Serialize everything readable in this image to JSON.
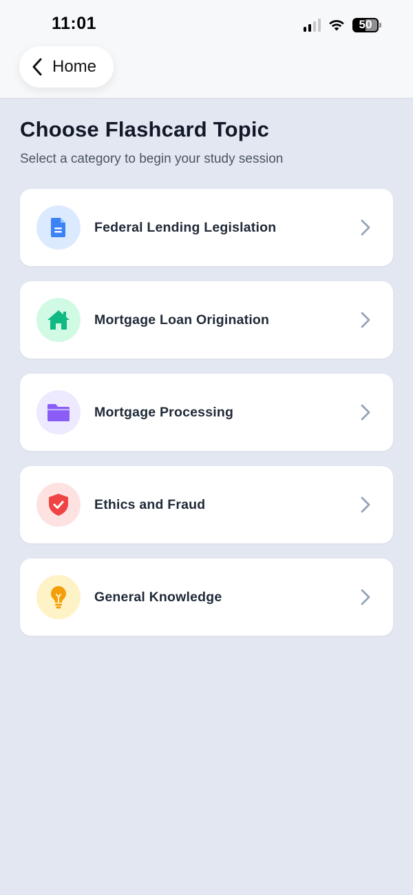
{
  "status_bar": {
    "time": "11:01",
    "battery": "50"
  },
  "nav": {
    "back_label": "Home"
  },
  "header": {
    "title": "Choose Flashcard Topic",
    "subtitle": "Select a category to begin your study session"
  },
  "topics": [
    {
      "label": "Federal Lending Legislation",
      "icon": "document-icon",
      "icon_color": "#3b82f6",
      "icon_bg": "#dbeafe"
    },
    {
      "label": "Mortgage Loan Origination",
      "icon": "house-icon",
      "icon_color": "#10b981",
      "icon_bg": "#d1fae5"
    },
    {
      "label": "Mortgage Processing",
      "icon": "folder-icon",
      "icon_color": "#8b5cf6",
      "icon_bg": "#ede9fe"
    },
    {
      "label": "Ethics and Fraud",
      "icon": "shield-check-icon",
      "icon_color": "#ef4444",
      "icon_bg": "#fee2e2"
    },
    {
      "label": "General Knowledge",
      "icon": "lightbulb-icon",
      "icon_color": "#f59e0b",
      "icon_bg": "#fef3c7"
    }
  ],
  "colors": {
    "background": "#e3e7f1",
    "card": "#ffffff",
    "chevron": "#94a3b8"
  }
}
